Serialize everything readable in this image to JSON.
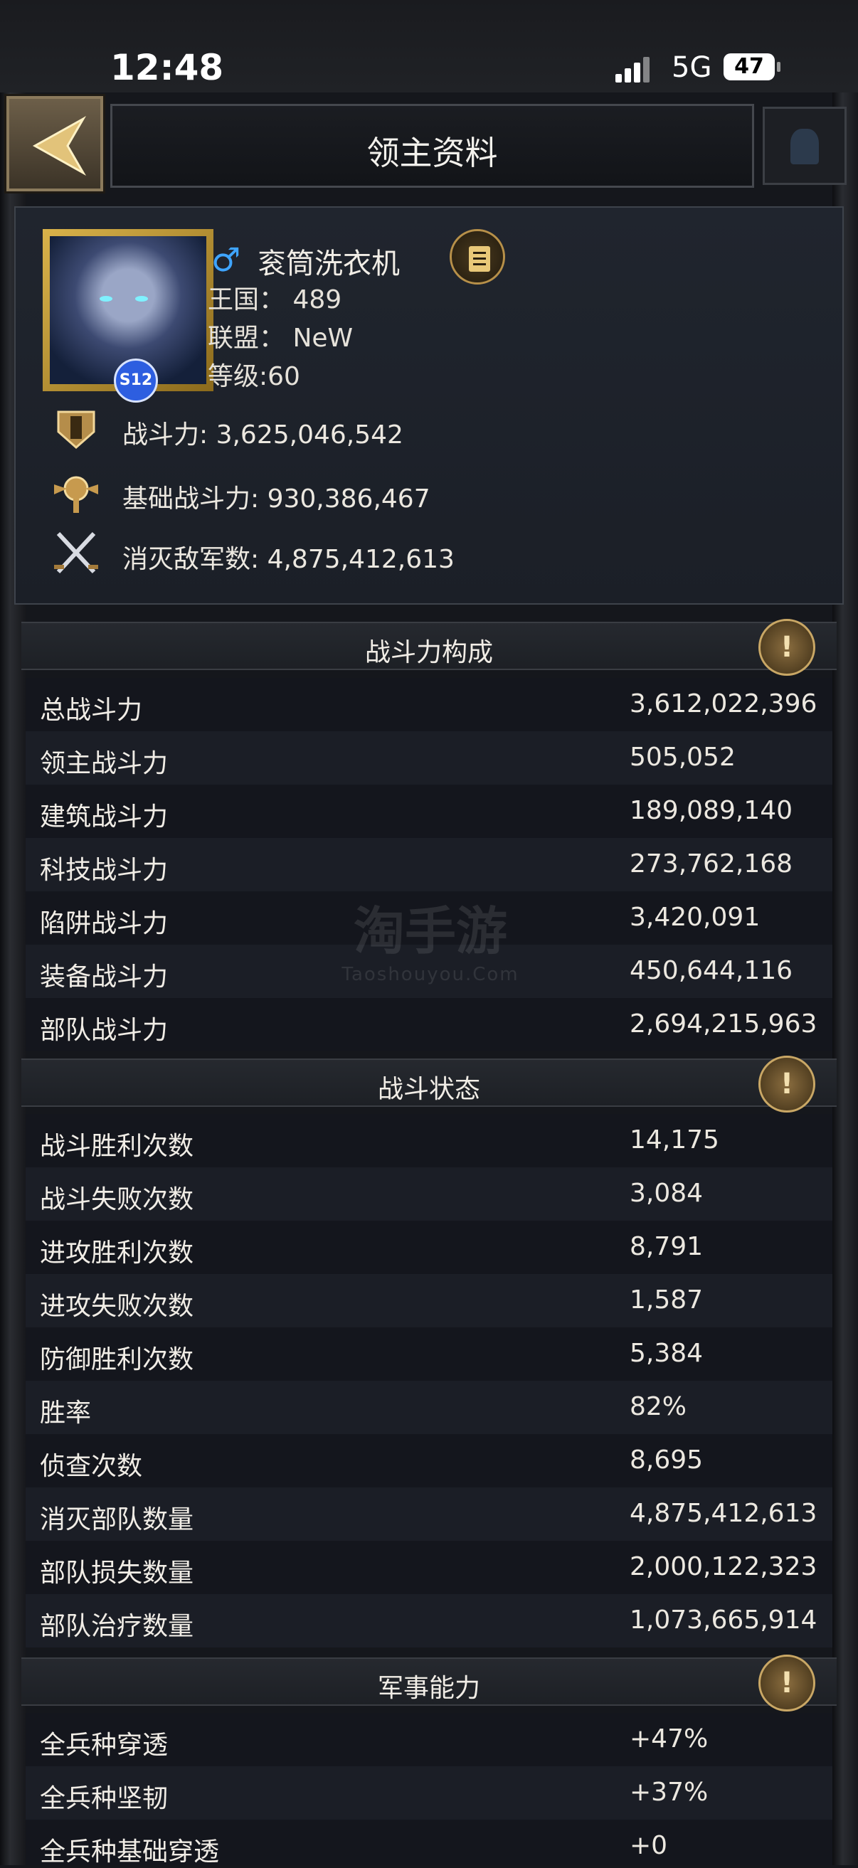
{
  "status": {
    "time": "12:48",
    "network": "5G",
    "battery": "47"
  },
  "header": {
    "title": "领主资料"
  },
  "profile": {
    "gender_symbol": "♂",
    "name": "衮筒洗衣机",
    "kingdom": "王国： 489",
    "alliance": "联盟： NeW",
    "level": "等级:60",
    "vip": "S12",
    "stats": [
      {
        "label": "战斗力: 3,625,046,542",
        "icon": "power-shield-icon"
      },
      {
        "label": "基础战斗力: 930,386,467",
        "icon": "winged-emblem-icon"
      },
      {
        "label": "消灭敌军数: 4,875,412,613",
        "icon": "crossed-swords-icon"
      }
    ]
  },
  "sections": [
    {
      "title": "战斗力构成",
      "rows": [
        {
          "label": "总战斗力",
          "value": "3,612,022,396"
        },
        {
          "label": "领主战斗力",
          "value": "505,052"
        },
        {
          "label": "建筑战斗力",
          "value": "189,089,140"
        },
        {
          "label": "科技战斗力",
          "value": "273,762,168"
        },
        {
          "label": "陷阱战斗力",
          "value": "3,420,091"
        },
        {
          "label": "装备战斗力",
          "value": "450,644,116"
        },
        {
          "label": "部队战斗力",
          "value": "2,694,215,963"
        }
      ]
    },
    {
      "title": "战斗状态",
      "rows": [
        {
          "label": "战斗胜利次数",
          "value": "14,175"
        },
        {
          "label": "战斗失败次数",
          "value": "3,084"
        },
        {
          "label": "进攻胜利次数",
          "value": "8,791"
        },
        {
          "label": "进攻失败次数",
          "value": "1,587"
        },
        {
          "label": "防御胜利次数",
          "value": "5,384"
        },
        {
          "label": "胜率",
          "value": "82%"
        },
        {
          "label": "侦查次数",
          "value": "8,695"
        },
        {
          "label": "消灭部队数量",
          "value": "4,875,412,613"
        },
        {
          "label": "部队损失数量",
          "value": "2,000,122,323"
        },
        {
          "label": "部队治疗数量",
          "value": "1,073,665,914"
        }
      ]
    },
    {
      "title": "军事能力",
      "rows": [
        {
          "label": "全兵种穿透",
          "value": "+47%"
        },
        {
          "label": "全兵种坚韧",
          "value": "+37%"
        },
        {
          "label": "全兵种基础穿透",
          "value": "+0"
        }
      ]
    }
  ],
  "section_button_glyph": "!",
  "watermark": {
    "main": "淘手游",
    "sub": "Taoshouyou.Com"
  },
  "colors": {
    "gold": "#c9a765",
    "gender_blue": "#3fa5ff"
  }
}
